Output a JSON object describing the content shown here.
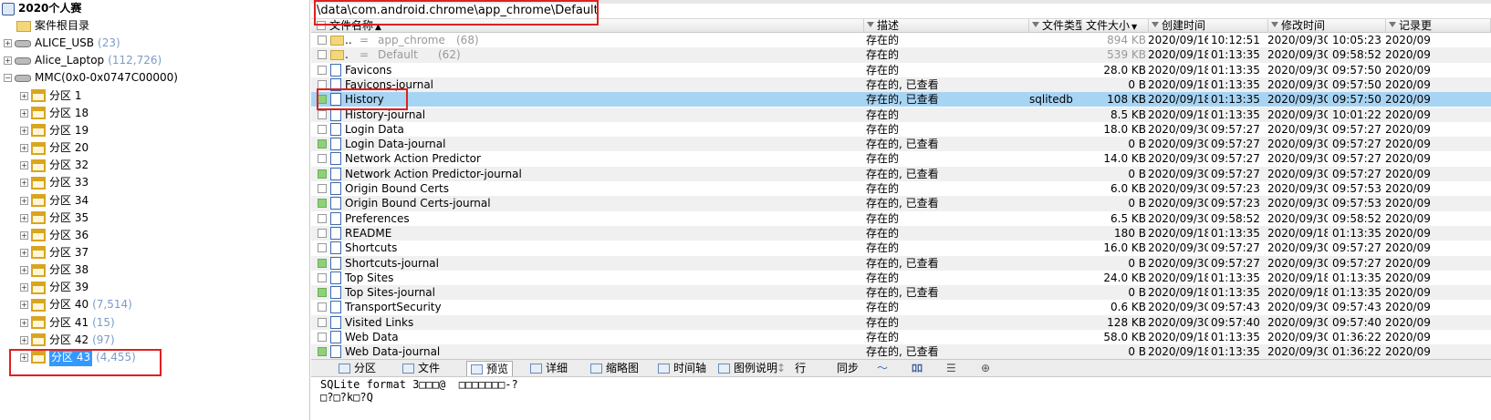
{
  "tree": {
    "root": {
      "label": "2020个人赛"
    },
    "nodes": [
      {
        "label": "案件根目录",
        "count": "",
        "icon": "folder-icon",
        "expander": "",
        "indent": 1
      },
      {
        "label": "ALICE_USB",
        "count": "(23)",
        "icon": "drive-icon",
        "expander": "+",
        "indent": 0
      },
      {
        "label": "Alice_Laptop",
        "count": "(112,726)",
        "icon": "drive-icon",
        "expander": "+",
        "indent": 0
      },
      {
        "label": "MMC(0x0-0x0747C00000)",
        "count": "",
        "icon": "drive-icon",
        "expander": "-",
        "indent": 0
      },
      {
        "label": "分区 1",
        "count": "",
        "icon": "partition-icon",
        "expander": "+",
        "indent": 2
      },
      {
        "label": "分区 18",
        "count": "",
        "icon": "partition-icon",
        "expander": "+",
        "indent": 2
      },
      {
        "label": "分区 19",
        "count": "",
        "icon": "partition-icon",
        "expander": "+",
        "indent": 2
      },
      {
        "label": "分区 20",
        "count": "",
        "icon": "partition-icon",
        "expander": "+",
        "indent": 2
      },
      {
        "label": "分区 32",
        "count": "",
        "icon": "partition-icon",
        "expander": "+",
        "indent": 2
      },
      {
        "label": "分区 33",
        "count": "",
        "icon": "partition-icon",
        "expander": "+",
        "indent": 2
      },
      {
        "label": "分区 34",
        "count": "",
        "icon": "partition-icon",
        "expander": "+",
        "indent": 2
      },
      {
        "label": "分区 35",
        "count": "",
        "icon": "partition-icon",
        "expander": "+",
        "indent": 2
      },
      {
        "label": "分区 36",
        "count": "",
        "icon": "partition-icon",
        "expander": "+",
        "indent": 2
      },
      {
        "label": "分区 37",
        "count": "",
        "icon": "partition-icon",
        "expander": "+",
        "indent": 2
      },
      {
        "label": "分区 38",
        "count": "",
        "icon": "partition-icon",
        "expander": "+",
        "indent": 2
      },
      {
        "label": "分区 39",
        "count": "",
        "icon": "partition-icon",
        "expander": "+",
        "indent": 2
      },
      {
        "label": "分区 40",
        "count": "(7,514)",
        "icon": "partition-icon",
        "expander": "+",
        "indent": 2
      },
      {
        "label": "分区 41",
        "count": "(15)",
        "icon": "partition-icon",
        "expander": "+",
        "indent": 2
      },
      {
        "label": "分区 42",
        "count": "(97)",
        "icon": "partition-icon",
        "expander": "+",
        "indent": 2
      },
      {
        "label": "分区 43",
        "count": "(4,455)",
        "icon": "partition-icon",
        "expander": "+",
        "indent": 2,
        "selected": true
      }
    ]
  },
  "path": "\\data\\com.android.chrome\\app_chrome\\Default",
  "columns": {
    "name": "文件名称",
    "desc": "描述",
    "type": "文件类型",
    "size": "文件大小",
    "created": "创建时间",
    "modified": "修改时间",
    "record": "记录更"
  },
  "rows": [
    {
      "name": "..",
      "eq": "=",
      "parent": "app_chrome",
      "count": "(68)",
      "desc": "存在的",
      "type": "",
      "size": "894 KB",
      "cdate": "2020/09/16",
      "ctime": "10:12:51",
      "mdate": "2020/09/30",
      "mtime": "10:05:23",
      "rdate": "2020/09",
      "kind": "folder",
      "green": false,
      "muted": true
    },
    {
      "name": ".",
      "eq": "=",
      "parent": "Default",
      "count": "(62)",
      "desc": "存在的",
      "type": "",
      "size": "539 KB",
      "cdate": "2020/09/18",
      "ctime": "01:13:35",
      "mdate": "2020/09/30",
      "mtime": "09:58:52",
      "rdate": "2020/09",
      "kind": "folder",
      "green": false,
      "muted": true
    },
    {
      "name": "Favicons",
      "desc": "存在的",
      "type": "",
      "size": "28.0 KB",
      "cdate": "2020/09/18",
      "ctime": "01:13:35",
      "mdate": "2020/09/30",
      "mtime": "09:57:50",
      "rdate": "2020/09",
      "kind": "file",
      "green": false
    },
    {
      "name": "Favicons-journal",
      "desc": "存在的, 已查看",
      "type": "",
      "size": "0 B",
      "cdate": "2020/09/18",
      "ctime": "01:13:35",
      "mdate": "2020/09/30",
      "mtime": "09:57:50",
      "rdate": "2020/09",
      "kind": "file",
      "green": false
    },
    {
      "name": "History",
      "desc": "存在的, 已查看",
      "type": "sqlitedb",
      "size": "108 KB",
      "cdate": "2020/09/18",
      "ctime": "01:13:35",
      "mdate": "2020/09/30",
      "mtime": "09:57:50",
      "rdate": "2020/09",
      "kind": "file",
      "green": true,
      "highlight": true
    },
    {
      "name": "History-journal",
      "desc": "存在的",
      "type": "",
      "size": "8.5 KB",
      "cdate": "2020/09/18",
      "ctime": "01:13:35",
      "mdate": "2020/09/30",
      "mtime": "10:01:22",
      "rdate": "2020/09",
      "kind": "file",
      "green": false
    },
    {
      "name": "Login Data",
      "desc": "存在的",
      "type": "",
      "size": "18.0 KB",
      "cdate": "2020/09/30",
      "ctime": "09:57:27",
      "mdate": "2020/09/30",
      "mtime": "09:57:27",
      "rdate": "2020/09",
      "kind": "file",
      "green": false
    },
    {
      "name": "Login Data-journal",
      "desc": "存在的, 已查看",
      "type": "",
      "size": "0 B",
      "cdate": "2020/09/30",
      "ctime": "09:57:27",
      "mdate": "2020/09/30",
      "mtime": "09:57:27",
      "rdate": "2020/09",
      "kind": "file",
      "green": true
    },
    {
      "name": "Network Action Predictor",
      "desc": "存在的",
      "type": "",
      "size": "14.0 KB",
      "cdate": "2020/09/30",
      "ctime": "09:57:27",
      "mdate": "2020/09/30",
      "mtime": "09:57:27",
      "rdate": "2020/09",
      "kind": "file",
      "green": false
    },
    {
      "name": "Network Action Predictor-journal",
      "desc": "存在的, 已查看",
      "type": "",
      "size": "0 B",
      "cdate": "2020/09/30",
      "ctime": "09:57:27",
      "mdate": "2020/09/30",
      "mtime": "09:57:27",
      "rdate": "2020/09",
      "kind": "file",
      "green": true
    },
    {
      "name": "Origin Bound Certs",
      "desc": "存在的",
      "type": "",
      "size": "6.0 KB",
      "cdate": "2020/09/30",
      "ctime": "09:57:23",
      "mdate": "2020/09/30",
      "mtime": "09:57:53",
      "rdate": "2020/09",
      "kind": "file",
      "green": false
    },
    {
      "name": "Origin Bound Certs-journal",
      "desc": "存在的, 已查看",
      "type": "",
      "size": "0 B",
      "cdate": "2020/09/30",
      "ctime": "09:57:23",
      "mdate": "2020/09/30",
      "mtime": "09:57:53",
      "rdate": "2020/09",
      "kind": "file",
      "green": true
    },
    {
      "name": "Preferences",
      "desc": "存在的",
      "type": "",
      "size": "6.5 KB",
      "cdate": "2020/09/30",
      "ctime": "09:58:52",
      "mdate": "2020/09/30",
      "mtime": "09:58:52",
      "rdate": "2020/09",
      "kind": "file",
      "green": false
    },
    {
      "name": "README",
      "desc": "存在的",
      "type": "",
      "size": "180 B",
      "cdate": "2020/09/18",
      "ctime": "01:13:35",
      "mdate": "2020/09/18",
      "mtime": "01:13:35",
      "rdate": "2020/09",
      "kind": "file",
      "green": false
    },
    {
      "name": "Shortcuts",
      "desc": "存在的",
      "type": "",
      "size": "16.0 KB",
      "cdate": "2020/09/30",
      "ctime": "09:57:27",
      "mdate": "2020/09/30",
      "mtime": "09:57:27",
      "rdate": "2020/09",
      "kind": "file",
      "green": false
    },
    {
      "name": "Shortcuts-journal",
      "desc": "存在的, 已查看",
      "type": "",
      "size": "0 B",
      "cdate": "2020/09/30",
      "ctime": "09:57:27",
      "mdate": "2020/09/30",
      "mtime": "09:57:27",
      "rdate": "2020/09",
      "kind": "file",
      "green": true
    },
    {
      "name": "Top Sites",
      "desc": "存在的",
      "type": "",
      "size": "24.0 KB",
      "cdate": "2020/09/18",
      "ctime": "01:13:35",
      "mdate": "2020/09/18",
      "mtime": "01:13:35",
      "rdate": "2020/09",
      "kind": "file",
      "green": false
    },
    {
      "name": "Top Sites-journal",
      "desc": "存在的, 已查看",
      "type": "",
      "size": "0 B",
      "cdate": "2020/09/18",
      "ctime": "01:13:35",
      "mdate": "2020/09/18",
      "mtime": "01:13:35",
      "rdate": "2020/09",
      "kind": "file",
      "green": true
    },
    {
      "name": "TransportSecurity",
      "desc": "存在的",
      "type": "",
      "size": "0.6 KB",
      "cdate": "2020/09/30",
      "ctime": "09:57:43",
      "mdate": "2020/09/30",
      "mtime": "09:57:43",
      "rdate": "2020/09",
      "kind": "file",
      "green": false
    },
    {
      "name": "Visited Links",
      "desc": "存在的",
      "type": "",
      "size": "128 KB",
      "cdate": "2020/09/30",
      "ctime": "09:57:40",
      "mdate": "2020/09/30",
      "mtime": "09:57:40",
      "rdate": "2020/09",
      "kind": "file",
      "green": false
    },
    {
      "name": "Web Data",
      "desc": "存在的",
      "type": "",
      "size": "58.0 KB",
      "cdate": "2020/09/18",
      "ctime": "01:13:35",
      "mdate": "2020/09/30",
      "mtime": "01:36:22",
      "rdate": "2020/09",
      "kind": "file",
      "green": false
    },
    {
      "name": "Web Data-journal",
      "desc": "存在的, 已查看",
      "type": "",
      "size": "0 B",
      "cdate": "2020/09/18",
      "ctime": "01:13:35",
      "mdate": "2020/09/30",
      "mtime": "01:36:22",
      "rdate": "2020/09",
      "kind": "file",
      "green": true
    }
  ],
  "bottom_tabs": [
    {
      "label": "分区",
      "icon": "partition-tab-icon"
    },
    {
      "label": "文件",
      "icon": "file-tab-icon"
    },
    {
      "label": "预览",
      "icon": "preview-tab-icon",
      "active": true
    },
    {
      "label": "详细",
      "icon": "detail-tab-icon"
    },
    {
      "label": "缩略图",
      "icon": "thumbnail-tab-icon"
    },
    {
      "label": "时间轴",
      "icon": "timeline-tab-icon"
    },
    {
      "label": "图例说明",
      "icon": "legend-tab-icon"
    }
  ],
  "bottom_tools": {
    "row": "行",
    "sync": "同步"
  },
  "preview": {
    "line1": "SQLite format 3□□□@  □□□□□□□-?",
    "line2": "□?□?k□?Q"
  },
  "colors": {
    "highlight": "#a8d4f4",
    "annotation": "#e02020",
    "selected_node": "#3399ff",
    "count_text": "#7a9cc8",
    "viewed_marker": "#8fd07a"
  }
}
